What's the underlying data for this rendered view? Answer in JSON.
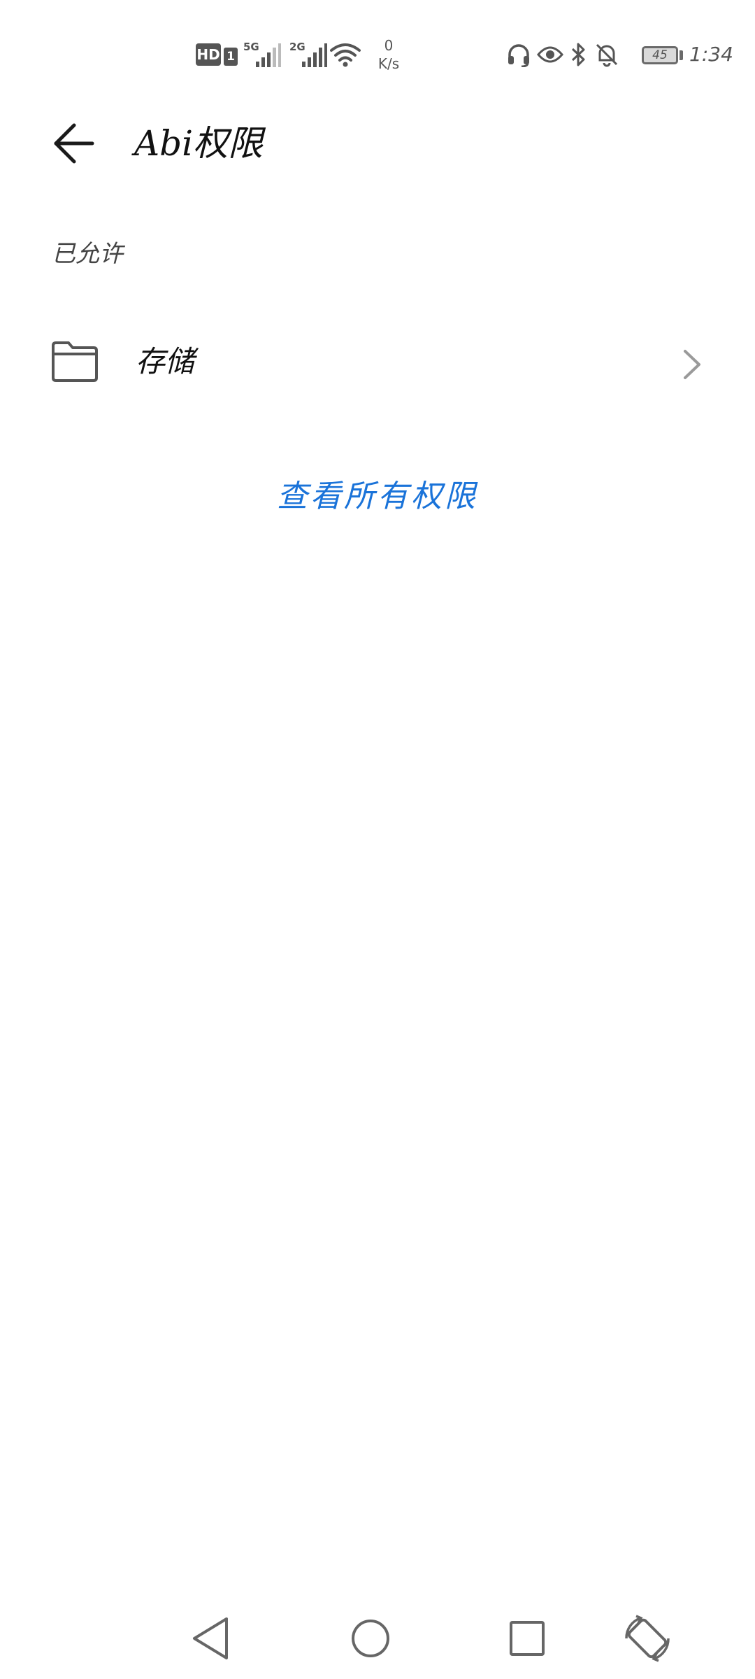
{
  "status_bar": {
    "hd_badge": "HD",
    "sim_number": "1",
    "network_1": "5G",
    "network_2": "2G",
    "speed_value": "0",
    "speed_unit": "K/s",
    "battery_level": "45",
    "time": "1:34",
    "icons": [
      "headset-icon",
      "eye-icon",
      "bluetooth-icon",
      "bell-off-icon"
    ]
  },
  "header": {
    "title": "Abi权限",
    "back_icon": "arrow-left-icon"
  },
  "section": {
    "label": "已允许",
    "items": [
      {
        "label": "存储",
        "icon": "folder-icon"
      }
    ]
  },
  "view_all_label": "查看所有权限",
  "nav_bar": {
    "buttons": [
      "back-triangle-icon",
      "home-circle-icon",
      "recents-square-icon",
      "rotate-screen-icon"
    ]
  },
  "colors": {
    "accent": "#1a73d9",
    "text_primary": "#111111",
    "text_secondary": "#444444",
    "icon_gray": "#555555"
  }
}
